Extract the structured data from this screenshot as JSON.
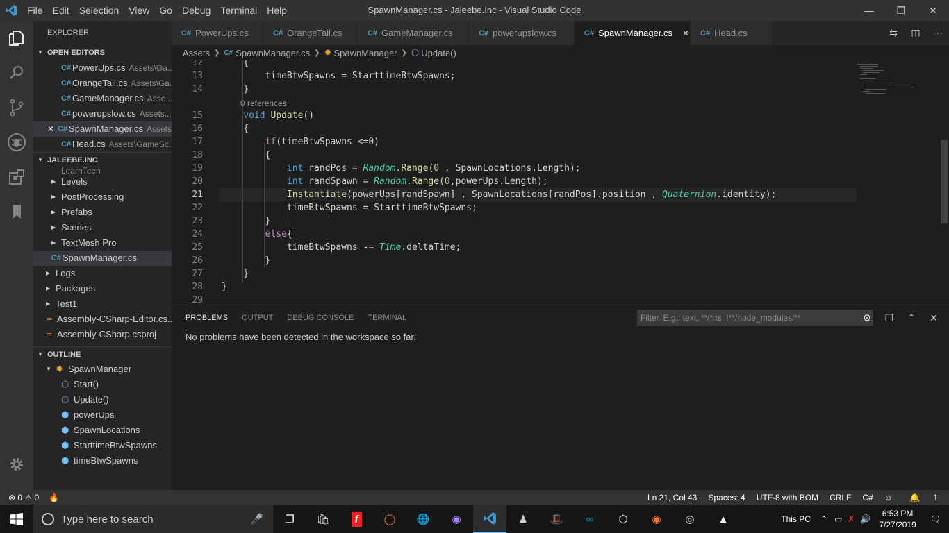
{
  "menu": [
    "File",
    "Edit",
    "Selection",
    "View",
    "Go",
    "Debug",
    "Terminal",
    "Help"
  ],
  "window_title": "SpawnManager.cs - Jaleebe.Inc - Visual Studio Code",
  "sidebar": {
    "title": "EXPLORER",
    "open_editors_title": "OPEN EDITORS",
    "open_editors": [
      {
        "name": "PowerUps.cs",
        "path": "Assets\\Ga..."
      },
      {
        "name": "OrangeTail.cs",
        "path": "Assets\\Ga..."
      },
      {
        "name": "GameManager.cs",
        "path": "Asse..."
      },
      {
        "name": "powerupslow.cs",
        "path": "Assets..."
      },
      {
        "name": "SpawnManager.cs",
        "path": "Assets"
      },
      {
        "name": "Head.cs",
        "path": "Assets\\GameSc..."
      }
    ],
    "workspace_title": "JALEEBE.INC",
    "tree_partial": "LearnTeen",
    "tree": [
      "Levels",
      "PostProcessing",
      "Prefabs",
      "Scenes",
      "TextMesh Pro"
    ],
    "selected_file": "SpawnManager.cs",
    "root_folders": [
      "Logs",
      "Packages",
      "Test1"
    ],
    "files": [
      "Assembly-CSharp-Editor.cs...",
      "Assembly-CSharp.csproj"
    ],
    "outline_title": "OUTLINE",
    "outline_root": "SpawnManager",
    "outline": [
      "Start()",
      "Update()",
      "powerUps",
      "SpawnLocations",
      "StarttimeBtwSpawns",
      "timeBtwSpawns"
    ]
  },
  "tabs": [
    "PowerUps.cs",
    "OrangeTail.cs",
    "GameManager.cs",
    "powerupslow.cs",
    "SpawnManager.cs",
    "Head.cs"
  ],
  "active_tab": "SpawnManager.cs",
  "breadcrumbs": [
    "Assets",
    "SpawnManager.cs",
    "SpawnManager",
    "Update()"
  ],
  "editor": {
    "line_numbers": [
      "12",
      "13",
      "14",
      "15",
      "16",
      "17",
      "18",
      "19",
      "20",
      "21",
      "22",
      "23",
      "24",
      "25",
      "26",
      "27",
      "28",
      "29"
    ],
    "codelens": "0 references"
  },
  "panel": {
    "tabs": [
      "PROBLEMS",
      "OUTPUT",
      "DEBUG CONSOLE",
      "TERMINAL"
    ],
    "filter_placeholder": "Filter. E.g.: text, **/*.ts, !**/node_modules/**",
    "message": "No problems have been detected in the workspace so far."
  },
  "status": {
    "errors": "0",
    "warnings": "0",
    "position": "Ln 21, Col 43",
    "spaces": "Spaces: 4",
    "encoding": "UTF-8 with BOM",
    "eol": "CRLF",
    "language": "C#",
    "notifications": "1"
  },
  "taskbar": {
    "search_placeholder": "Type here to search",
    "this_pc": "This PC",
    "time": "6:53 PM",
    "date": "7/27/2019"
  },
  "colors": {
    "accent": "#007acc",
    "statusbar": "#333333",
    "editor_bg": "#1e1e1e"
  }
}
